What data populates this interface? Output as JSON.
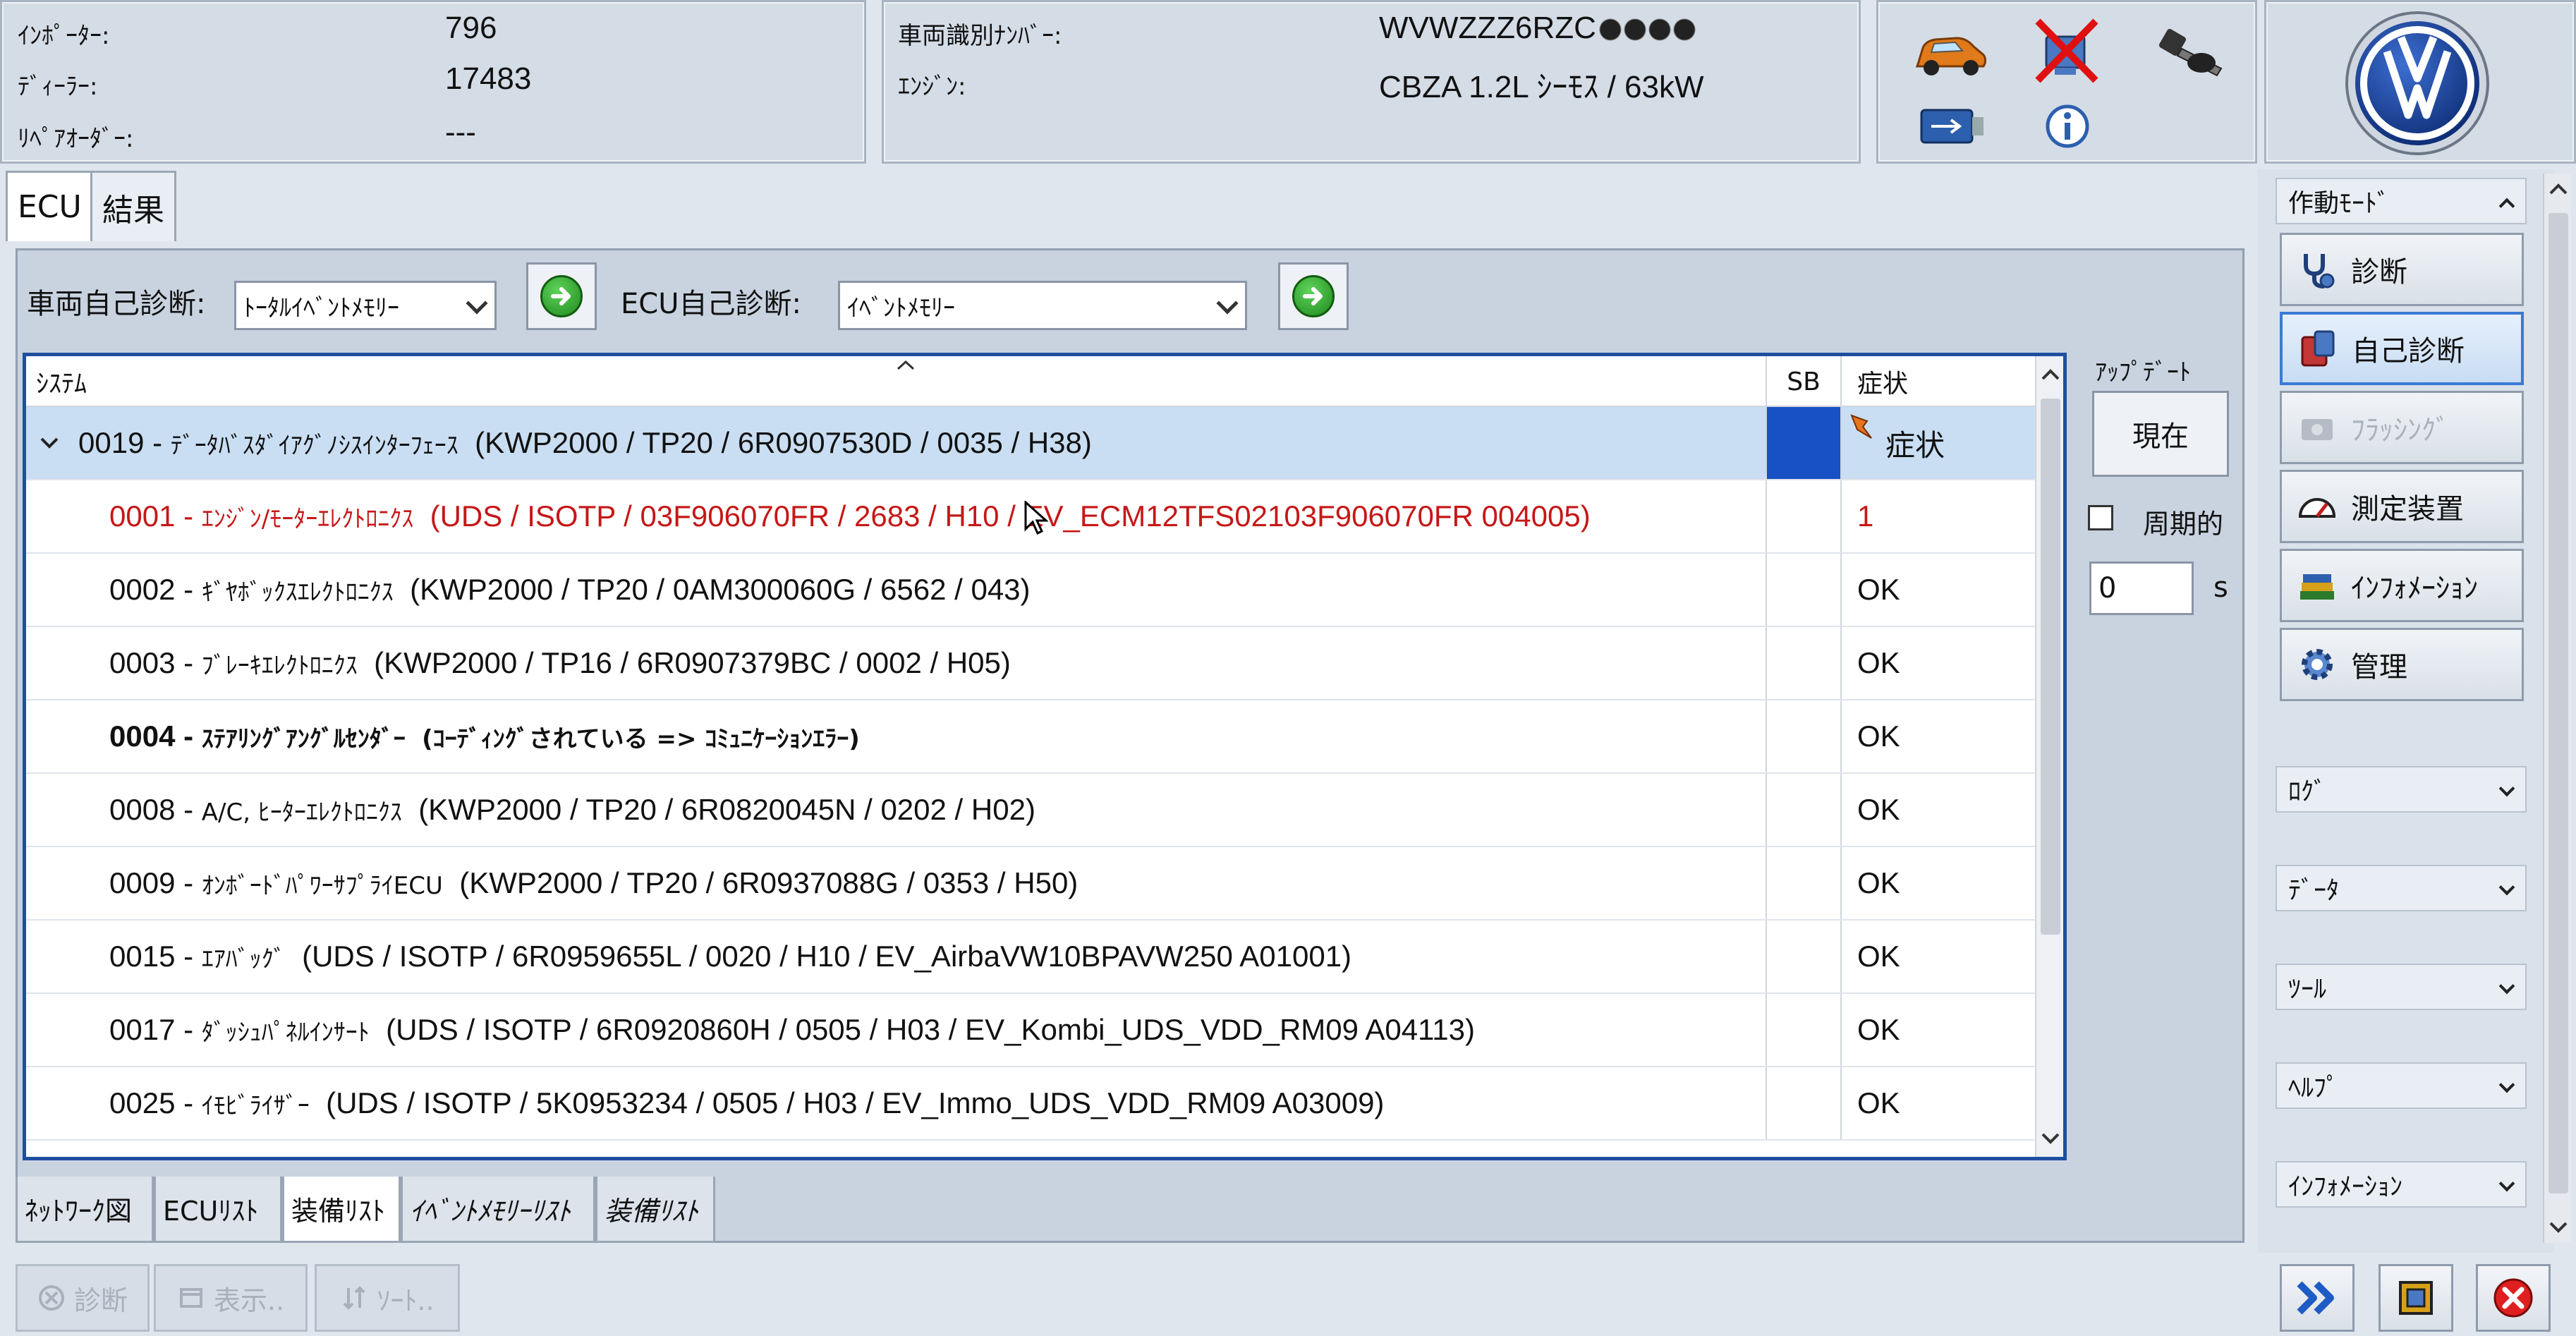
{
  "header": {
    "importer_label": "ｲﾝﾎﾟｰﾀｰ:",
    "importer_value": "796",
    "dealer_label": "ﾃﾞｨｰﾗｰ:",
    "dealer_value": "17483",
    "repair_order_label": "ﾘﾍﾟｱｵｰﾀﾞｰ:",
    "repair_order_value": "---",
    "vin_label": "車両識別ﾅﾝﾊﾞｰ:",
    "vin_value": "WVWZZZ6RZC",
    "engine_label": "ｴﾝｼﾞﾝ:",
    "engine_value": "CBZA 1.2L ｼｰﾓｽ / 63kW"
  },
  "tabs": [
    {
      "label": "ECU"
    },
    {
      "label": "結果"
    }
  ],
  "controls": {
    "vehicle_diag_label": "車両自己診断:",
    "vehicle_diag_value": "ﾄｰﾀﾙｲﾍﾞﾝﾄﾒﾓﾘｰ",
    "ecu_diag_label": "ECU自己診断:",
    "ecu_diag_value": "ｲﾍﾞﾝﾄﾒﾓﾘｰ"
  },
  "table": {
    "headers": {
      "system": "ｼｽﾃﾑ",
      "sb": "SB",
      "symptom": "症状"
    },
    "rows": [
      {
        "code": "0019",
        "name": "ﾃﾞｰﾀﾊﾞｽﾀﾞｲｱｸﾞﾉｼｽｲﾝﾀｰﾌｪｰｽ",
        "detail": "(KWP2000 / TP20 / 6R0907530D / 0035 / H38)",
        "symptom": "症状"
      },
      {
        "code": "0001",
        "name": "ｴﾝｼﾞﾝ/ﾓｰﾀｰｴﾚｸﾄﾛﾆｸｽ",
        "detail": "(UDS / ISOTP / 03F906070FR / 2683 / H10 / EV_ECM12TFS02103F906070FR 004005)",
        "symptom": "1"
      },
      {
        "code": "0002",
        "name": "ｷﾞﾔﾎﾞｯｸｽｴﾚｸﾄﾛﾆｸｽ",
        "detail": "(KWP2000 / TP20 / 0AM300060G / 6562 / 043)",
        "symptom": "OK"
      },
      {
        "code": "0003",
        "name": "ﾌﾞﾚｰｷｴﾚｸﾄﾛﾆｸｽ",
        "detail": "(KWP2000 / TP16 / 6R0907379BC / 0002 / H05)",
        "symptom": "OK"
      },
      {
        "code": "0004",
        "name": "ｽﾃｱﾘﾝｸﾞｱﾝｸﾞﾙｾﾝﾀﾞｰ",
        "detail": "(ｺｰﾃﾞｨﾝｸﾞされている => ｺﾐｭﾆｹｰｼｮﾝｴﾗｰ)",
        "symptom": "OK"
      },
      {
        "code": "0008",
        "name": "A/C, ﾋｰﾀｰｴﾚｸﾄﾛﾆｸｽ",
        "detail": "(KWP2000 / TP20 / 6R0820045N / 0202 / H02)",
        "symptom": "OK"
      },
      {
        "code": "0009",
        "name": "ｵﾝﾎﾞｰﾄﾞﾊﾟﾜｰｻﾌﾟﾗｲECU",
        "detail": "(KWP2000 / TP20 / 6R0937088G / 0353 / H50)",
        "symptom": "OK"
      },
      {
        "code": "0015",
        "name": "ｴｱﾊﾞｯｸﾞ",
        "detail": "(UDS / ISOTP / 6R0959655L / 0020 / H10 / EV_AirbaVW10BPAVW250 A01001)",
        "symptom": "OK"
      },
      {
        "code": "0017",
        "name": "ﾀﾞｯｼｭﾊﾟﾈﾙｲﾝｻｰﾄ",
        "detail": "(UDS / ISOTP / 6R0920860H / 0505 / H03 / EV_Kombi_UDS_VDD_RM09 A04113)",
        "symptom": "OK"
      },
      {
        "code": "0025",
        "name": "ｲﾓﾋﾞﾗｲｻﾞｰ",
        "detail": "(UDS / ISOTP / 5K0953234 / 0505 / H03 / EV_Immo_UDS_VDD_RM09 A03009)",
        "symptom": "OK"
      }
    ]
  },
  "update": {
    "label": "ｱｯﾌﾟﾃﾞｰﾄ",
    "button": "現在",
    "periodic_label": "周期的",
    "interval_value": "0",
    "unit": "s"
  },
  "bottom_tabs": [
    {
      "label": "ﾈｯﾄﾜｰｸ図"
    },
    {
      "label": "ECUﾘｽﾄ"
    },
    {
      "label": "装備ﾘｽﾄ"
    },
    {
      "label": "ｲﾍﾞﾝﾄﾒﾓﾘｰﾘｽﾄ"
    },
    {
      "label": "装備ﾘｽﾄ"
    }
  ],
  "actions": [
    {
      "label": "診断"
    },
    {
      "label": "表示.."
    },
    {
      "label": "ｿｰﾄ.."
    }
  ],
  "sidebar": {
    "mode_header": "作動ﾓｰﾄﾞ",
    "buttons": [
      {
        "label": "診断"
      },
      {
        "label": "自己診断"
      },
      {
        "label": "ﾌﾗｯｼﾝｸﾞ"
      },
      {
        "label": "測定装置"
      },
      {
        "label": "ｲﾝﾌｫﾒｰｼｮﾝ"
      },
      {
        "label": "管理"
      }
    ],
    "sections": [
      {
        "label": "ﾛｸﾞ"
      },
      {
        "label": "ﾃﾞｰﾀ"
      },
      {
        "label": "ﾂｰﾙ"
      },
      {
        "label": "ﾍﾙﾌﾟ"
      },
      {
        "label": "ｲﾝﾌｫﾒｰｼｮﾝ"
      }
    ]
  }
}
